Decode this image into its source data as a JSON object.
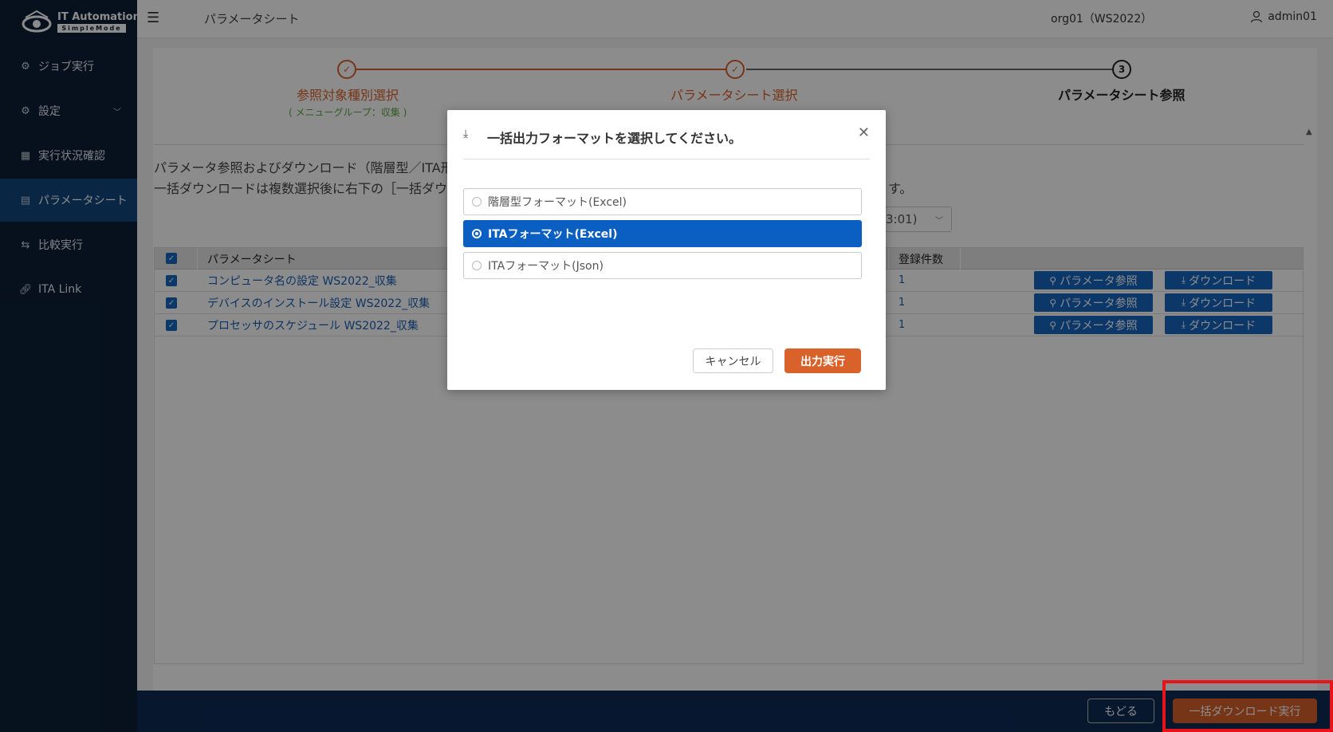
{
  "brand": {
    "name": "IT Automation",
    "sub": "SimpleMode"
  },
  "sidebar": {
    "items": [
      {
        "label": "ジョブ実行"
      },
      {
        "label": "設定"
      },
      {
        "label": "実行状況確認"
      },
      {
        "label": "パラメータシート"
      },
      {
        "label": "比較実行"
      },
      {
        "label": "ITA Link"
      }
    ]
  },
  "header": {
    "title": "パラメータシート",
    "workspace": "org01（WS2022）",
    "user": "admin01"
  },
  "stepper": {
    "steps": [
      {
        "label": "参照対象種別選択",
        "sub": "( メニューグループ：収集 )",
        "marker": "✓"
      },
      {
        "label": "パラメータシート選択",
        "marker": "✓"
      },
      {
        "label": "パラメータシート参照",
        "marker": "3"
      }
    ]
  },
  "description": {
    "line1": "パラメータ参照およびダウンロード（階層型／ITA形",
    "line1_tail": "",
    "line2": "一括ダウンロードは複数選択後に右下の［一括ダウ",
    "line2_tail": "す。"
  },
  "select": {
    "value": "3:01)"
  },
  "table": {
    "headers": {
      "sheet": "パラメータシート",
      "count": "登録件数"
    },
    "rows": [
      {
        "name": "コンピュータ名の設定 WS2022_収集",
        "count": "1"
      },
      {
        "name": "デバイスのインストール設定 WS2022_収集",
        "count": "1"
      },
      {
        "name": "プロセッサのスケジュール WS2022_収集",
        "count": "1"
      }
    ],
    "view_button": "パラメータ参照",
    "download_button": "ダウンロード"
  },
  "footer": {
    "back": "もどる",
    "bulk_download": "一括ダウンロード実行"
  },
  "modal": {
    "title": "一括出力フォーマットを選択してください。",
    "options": [
      {
        "label": "階層型フォーマット(Excel)"
      },
      {
        "label": "ITAフォーマット(Excel)"
      },
      {
        "label": "ITAフォーマット(Json)"
      }
    ],
    "selected_index": 1,
    "cancel": "キャンセル",
    "execute": "出力実行"
  },
  "colors": {
    "sidebar_bg": "#0b2035",
    "sidebar_active": "#12467e",
    "accent_orange": "#d9622b",
    "primary_blue": "#1565c0",
    "footer_bg": "#0d2a55",
    "highlight_red": "#e8141c"
  }
}
